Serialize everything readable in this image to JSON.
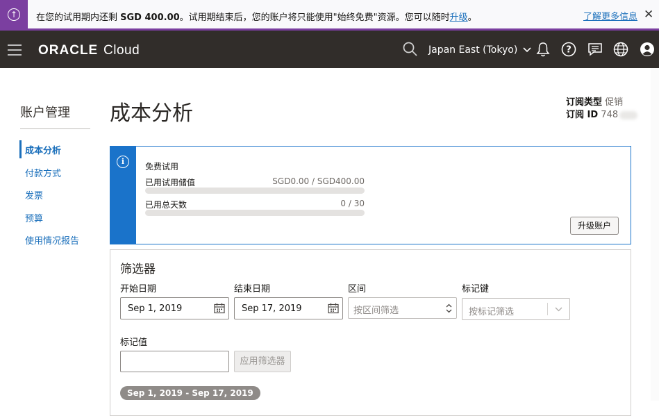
{
  "banner": {
    "msg_prefix": "在您的试用期内还剩 ",
    "msg_amount": "SGD 400.00",
    "msg_middle": "。试用期结束后，您的账户将只能使用\"始终免费\"资源。您可以随时",
    "msg_link": "升级",
    "msg_suffix": "。",
    "learn_more": "了解更多信息",
    "close": "✕"
  },
  "header": {
    "logo_oracle": "ORACLE",
    "logo_cloud": "Cloud",
    "region": "Japan East (Tokyo)"
  },
  "sidebar": {
    "title": "账户管理",
    "items": [
      {
        "label": "成本分析",
        "active": true
      },
      {
        "label": "付款方式",
        "active": false
      },
      {
        "label": "发票",
        "active": false
      },
      {
        "label": "预算",
        "active": false
      },
      {
        "label": "使用情况报告",
        "active": false
      }
    ]
  },
  "main": {
    "title": "成本分析",
    "subscription_type_key": "订阅类型",
    "subscription_type_value": "促销",
    "subscription_id_key": "订阅 ID",
    "subscription_id_value": "748"
  },
  "trial": {
    "heading": "免费试用",
    "credits_label": "已用试用储值",
    "credits_value": "SGD0.00 / SGD400.00",
    "credits_progress": 0,
    "days_label": "已用总天数",
    "days_value": "0 / 30",
    "days_progress": 0,
    "upgrade_button": "升级账户"
  },
  "filters": {
    "title": "筛选器",
    "start_label": "开始日期",
    "start_value": "Sep 1, 2019",
    "end_label": "结束日期",
    "end_value": "Sep 17, 2019",
    "compartment_label": "区间",
    "compartment_placeholder": "按区间筛选",
    "tagkey_label": "标记键",
    "tagkey_placeholder": "按标记筛选",
    "tagvalue_label": "标记值",
    "tagvalue_value": "",
    "apply_button": "应用筛选器",
    "date_range_chip": "Sep 1, 2019 - Sep 17, 2019"
  },
  "colors": {
    "accent_purple": "#7b3fa0",
    "header_bg": "#312d2a",
    "link_blue": "#1a6fbb",
    "info_blue": "#1a73ca"
  }
}
